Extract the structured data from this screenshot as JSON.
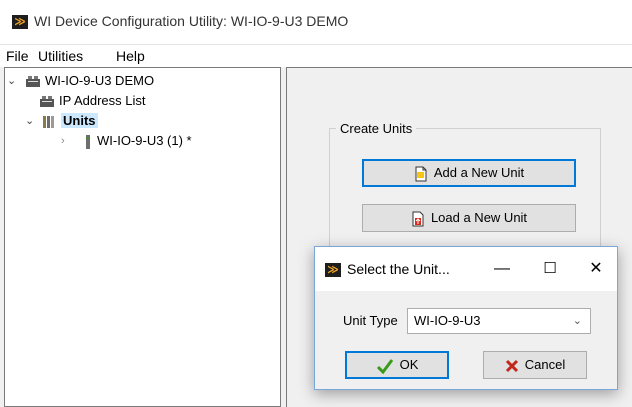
{
  "window": {
    "title": "WI Device Configuration Utility: WI-IO-9-U3 DEMO",
    "app_icon": "wi-logo"
  },
  "menu": [
    "File",
    "Utilities",
    "Help"
  ],
  "tree": {
    "root": "WI-IO-9-U3 DEMO",
    "ip_list": "IP Address List",
    "units": "Units",
    "unit_item": "WI-IO-9-U3 (1) *"
  },
  "create_units": {
    "group_title": "Create Units",
    "add_button": "Add a New Unit",
    "load_button": "Load a New Unit"
  },
  "dialog": {
    "title": "Select the Unit...",
    "minimize": "—",
    "maximize": "☐",
    "close": "✕",
    "unit_type_label": "Unit Type",
    "unit_type_value": "WI-IO-9-U3",
    "ok_label": "OK",
    "cancel_label": "Cancel"
  },
  "colors": {
    "accent": "#0078d7",
    "ok_check": "#3a9a1a",
    "cancel_x": "#c0281c"
  }
}
